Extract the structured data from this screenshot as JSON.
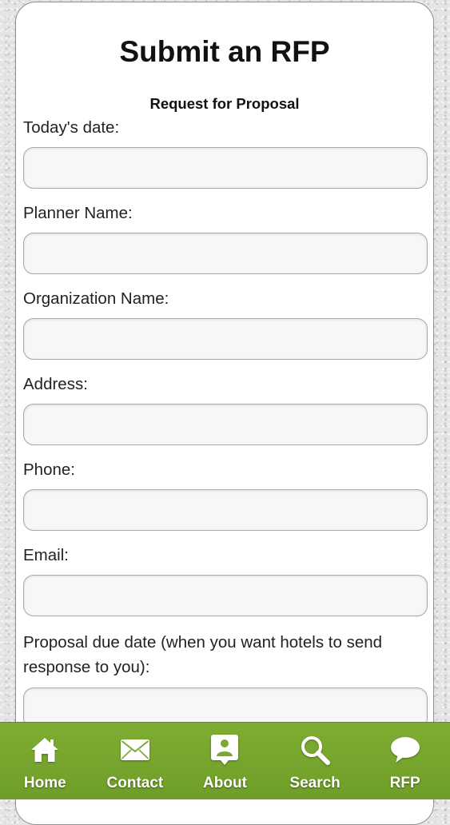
{
  "page": {
    "title": "Submit an RFP",
    "subtitle": "Request for Proposal"
  },
  "form": {
    "fields": [
      {
        "label": "Today's date:",
        "value": "",
        "placeholder": ""
      },
      {
        "label": "Planner Name:",
        "value": "",
        "placeholder": ""
      },
      {
        "label": "Organization Name:",
        "value": "",
        "placeholder": ""
      },
      {
        "label": "Address:",
        "value": "",
        "placeholder": ""
      },
      {
        "label": "Phone:",
        "value": "",
        "placeholder": ""
      },
      {
        "label": "Email:",
        "value": "",
        "placeholder": ""
      },
      {
        "label": "Proposal due date (when you want hotels to send response to you):",
        "value": "",
        "placeholder": ""
      }
    ]
  },
  "navbar": {
    "background": "#74a32c",
    "items": [
      {
        "label": "Home",
        "icon": "home-icon"
      },
      {
        "label": "Contact",
        "icon": "mail-icon"
      },
      {
        "label": "About",
        "icon": "contact-card-icon"
      },
      {
        "label": "Search",
        "icon": "search-icon"
      },
      {
        "label": "RFP",
        "icon": "speech-bubble-icon"
      }
    ]
  }
}
